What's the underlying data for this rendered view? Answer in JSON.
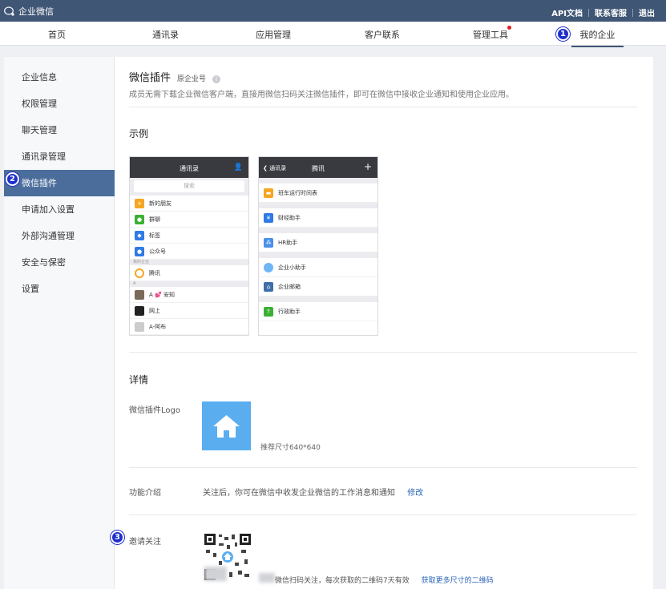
{
  "topbar": {
    "brand": "企业微信",
    "links": [
      "API文档",
      "联系客服",
      "退出"
    ]
  },
  "nav": {
    "items": [
      "首页",
      "通讯录",
      "应用管理",
      "客户联系",
      "管理工具",
      "我的企业"
    ],
    "active": "我的企业"
  },
  "badges": [
    "1",
    "2",
    "3"
  ],
  "sidebar": {
    "items": [
      "企业信息",
      "权限管理",
      "聊天管理",
      "通讯录管理",
      "微信插件",
      "申请加入设置",
      "外部沟通管理",
      "安全与保密",
      "设置"
    ],
    "active": "微信插件"
  },
  "main": {
    "title": "微信插件",
    "subtitle": "原企业号",
    "description": "成员无需下载企业微信客户端，直接用微信扫码关注微信插件，即可在微信中接收企业通知和使用企业应用。",
    "example_title": "示例",
    "phone1": {
      "title": "通讯录",
      "search": "搜索",
      "rows": [
        "新的朋友",
        "群聊",
        "标签",
        "公众号"
      ],
      "group_label": "我的企业",
      "company_row": "腾讯",
      "contacts": [
        "A 💕 安知",
        "网上",
        "A-阿布"
      ]
    },
    "phone2": {
      "back": "通讯录",
      "title": "腾讯",
      "rows": [
        "班车运行时间表",
        "财经助手",
        "HR助手",
        "企业小助手",
        "企业邮箱",
        "行政助手"
      ]
    },
    "details_title": "详情",
    "logo_label": "微信插件Logo",
    "logo_hint": "推荐尺寸640*640",
    "func_label": "功能介绍",
    "func_text": "关注后，你可在微信中收发企业微信的工作消息和通知",
    "func_edit": "修改",
    "invite_label": "邀请关注",
    "qr_text": "微信扫码关注，每次获取的二维码7天有效",
    "qr_link": "获取更多尺寸的二维码"
  },
  "colors": {
    "topbar": "#3f5675",
    "sidebar_active": "#4b6d9c",
    "badge": "#1f2fcc",
    "logo": "#5aaef0",
    "link": "#2a64b8"
  }
}
